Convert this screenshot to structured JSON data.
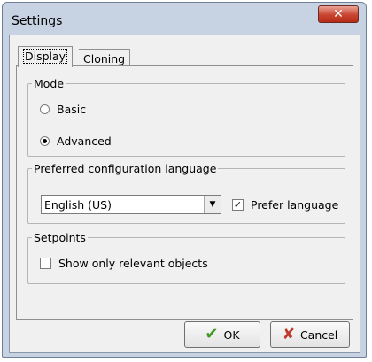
{
  "window": {
    "title": "Settings",
    "close_glyph": "✕"
  },
  "tabs": [
    {
      "label": "Display",
      "selected": true
    },
    {
      "label": "Cloning",
      "selected": false
    }
  ],
  "mode": {
    "legend": "Mode",
    "options": [
      {
        "label": "Basic",
        "checked": false
      },
      {
        "label": "Advanced",
        "checked": true
      }
    ]
  },
  "language": {
    "legend": "Preferred configuration language",
    "selected_value": "English (US)",
    "dropdown_glyph": "▼",
    "prefer_checkbox": {
      "label": "Prefer language",
      "checked": true,
      "check_glyph": "✓"
    }
  },
  "setpoints": {
    "legend": "Setpoints",
    "show_relevant": {
      "label": "Show only relevant objects",
      "checked": false
    }
  },
  "buttons": {
    "ok": {
      "label": "OK",
      "icon": "checkmark-icon",
      "icon_glyph": "✔"
    },
    "cancel": {
      "label": "Cancel",
      "icon": "x-icon",
      "icon_glyph": "✘"
    }
  },
  "colors": {
    "ok_icon": "#3c9a20",
    "cancel_icon": "#c0392b",
    "close_button": "#c94530"
  }
}
